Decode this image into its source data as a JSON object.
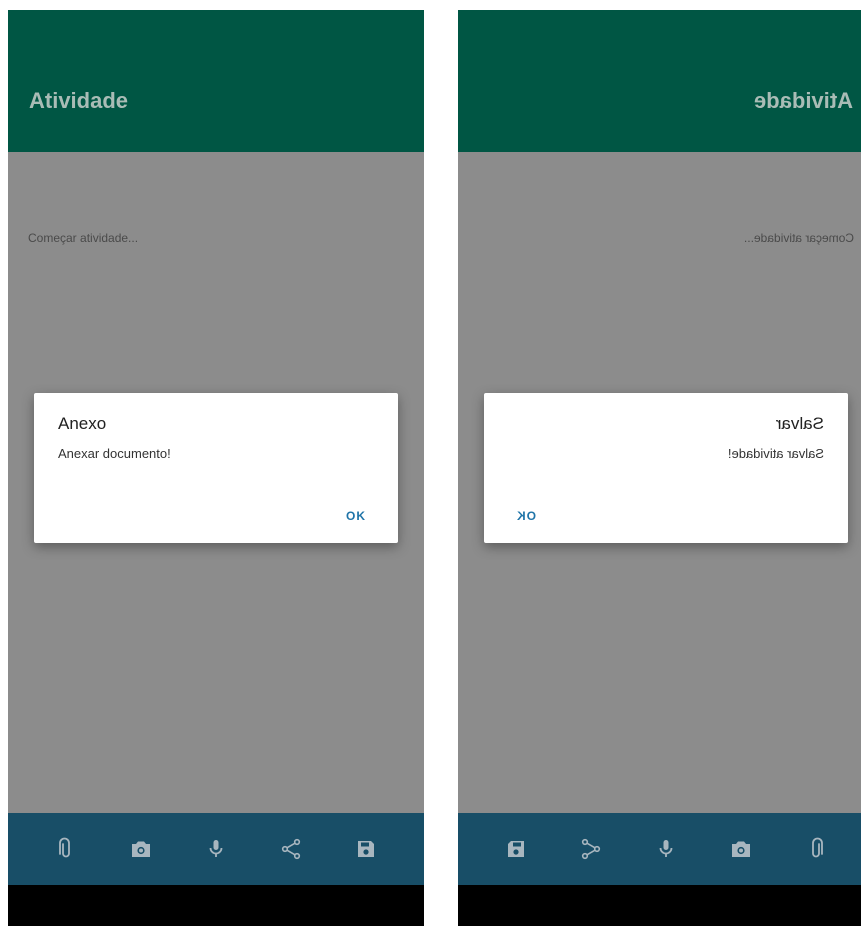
{
  "screens": [
    {
      "appbar": {
        "title": "Atividade"
      },
      "content": {
        "text": "Começar atividade..."
      },
      "dialog": {
        "title": "Anexo",
        "message": "Anexar documento!",
        "ok_label": "OK"
      },
      "toolbar_icons": [
        "attach-icon",
        "camera-icon",
        "microphone-icon",
        "share-icon",
        "save-icon"
      ]
    },
    {
      "appbar": {
        "title": "Atividade"
      },
      "content": {
        "text": "Começar atividade..."
      },
      "dialog": {
        "title": "Salvar",
        "message": "Salvar atividade!",
        "ok_label": "OK"
      },
      "toolbar_icons": [
        "attach-icon",
        "camera-icon",
        "microphone-icon",
        "share-icon",
        "save-icon"
      ],
      "mirrored": true
    }
  ],
  "colors": {
    "appbar": "#005644",
    "appbar_title": "#a9bcb6",
    "scrim_background": "#8c8c8c",
    "bottom_toolbar": "#184e67",
    "toolbar_icon": "#a8b6bf",
    "dialog_button": "#1f74a8"
  }
}
